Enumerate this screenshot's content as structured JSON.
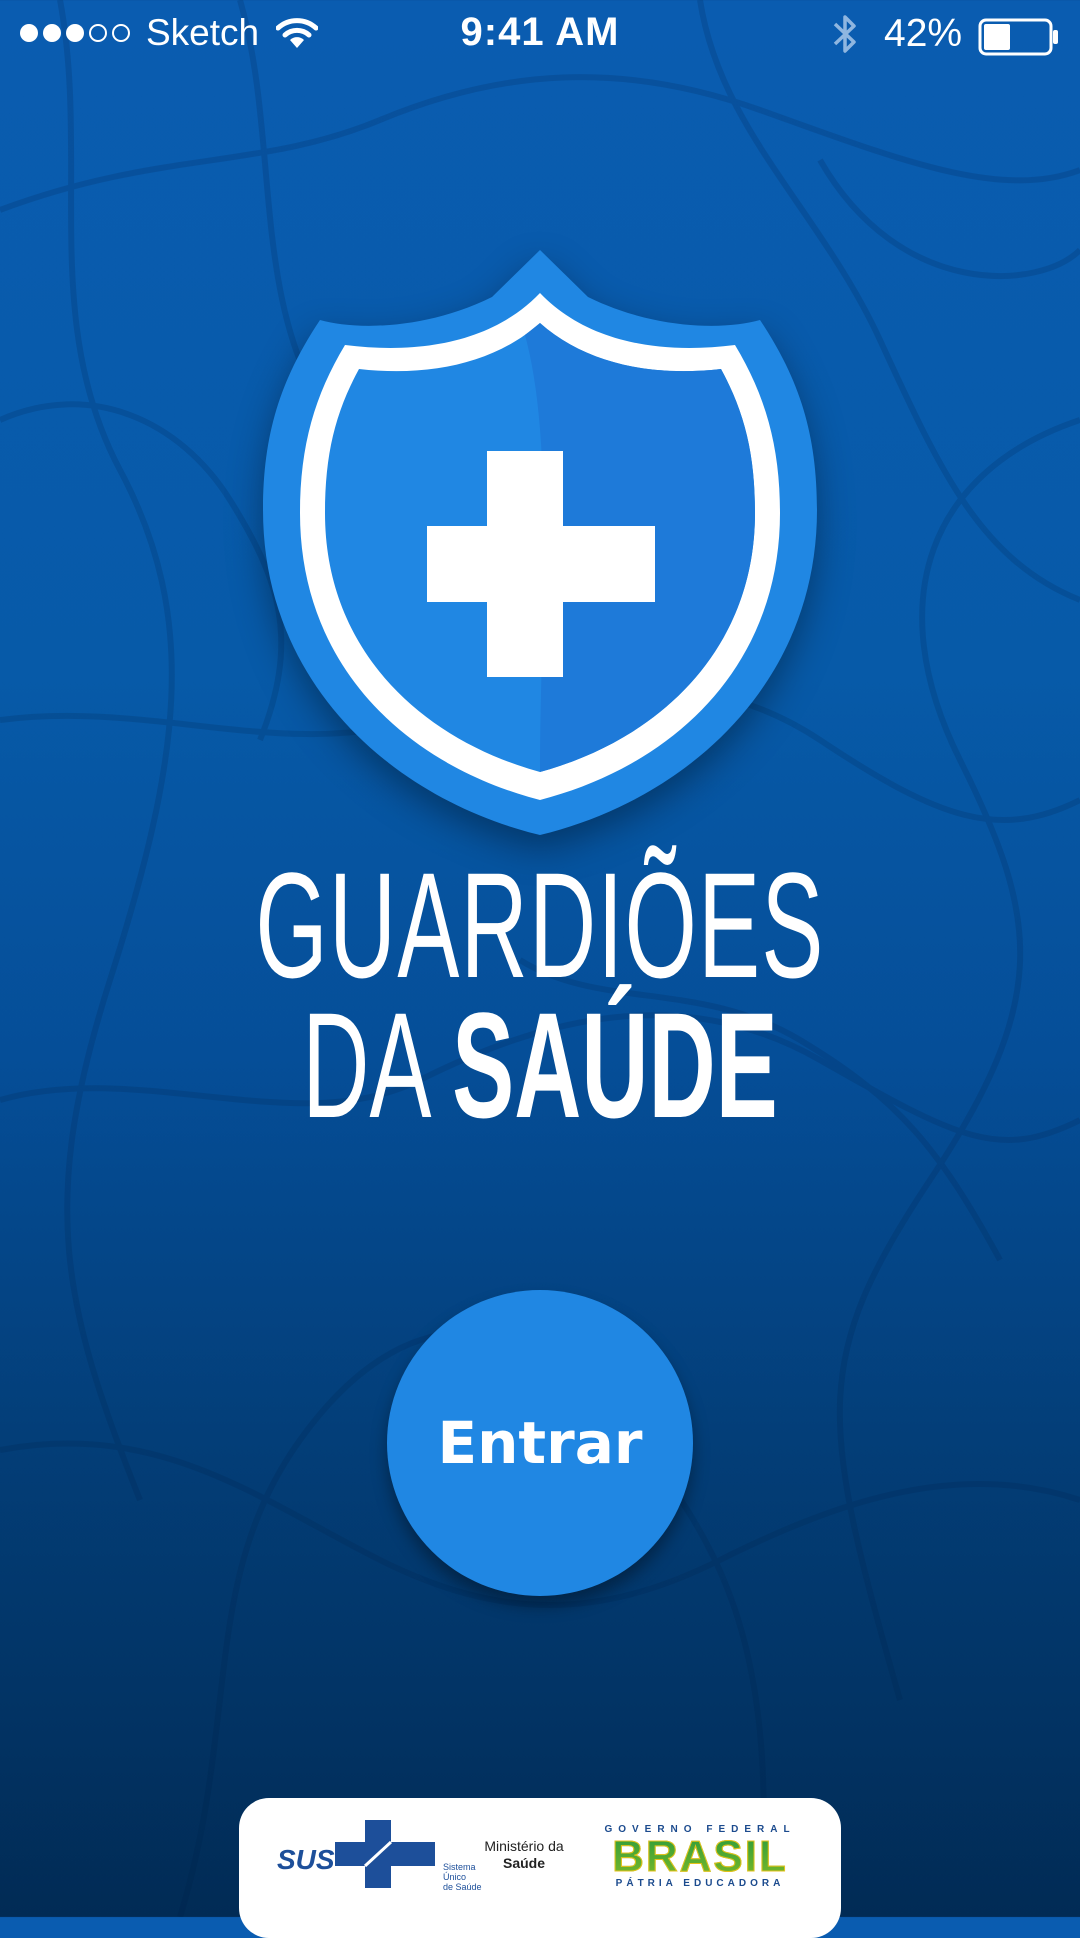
{
  "status_bar": {
    "signal_filled": 3,
    "signal_total": 5,
    "carrier": "Sketch",
    "time": "9:41 AM",
    "battery_percent": "42%",
    "battery_level": 0.42,
    "wifi_icon": "wifi-icon",
    "bluetooth_icon": "bluetooth-icon",
    "battery_icon": "battery-icon"
  },
  "logo": {
    "icon": "shield-cross-icon",
    "title_line1": "GUARDIÕES",
    "title_line2_thin": "DA",
    "title_line2_bold": "SAÚDE"
  },
  "enter_button": {
    "label": "Entrar"
  },
  "footer": {
    "sus": {
      "text": "SUS",
      "subtitle_1": "Sistema",
      "subtitle_2": "Único",
      "subtitle_3": "de Saúde"
    },
    "ministry": {
      "line1": "Ministério da",
      "line2": "Saúde"
    },
    "government": {
      "top": "GOVERNO FEDERAL",
      "main": "BRASIL",
      "bottom": "PÁTRIA EDUCADORA"
    }
  },
  "colors": {
    "background_top": "#0a5cb0",
    "background_bottom": "#012b55",
    "accent": "#2087e3",
    "shield_dark": "#1e7ad9"
  }
}
